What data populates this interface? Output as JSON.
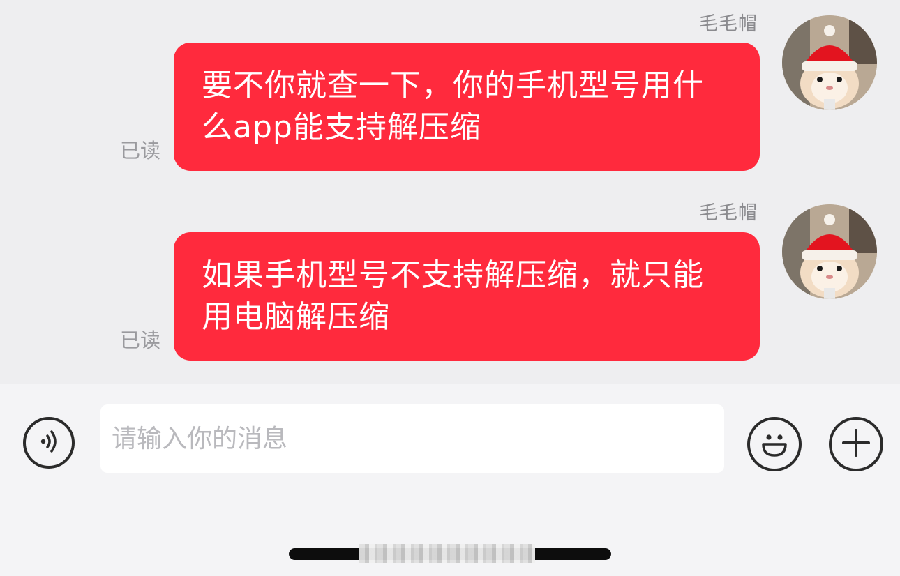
{
  "messages": [
    {
      "sender": "毛毛帽",
      "text": "要不你就查一下，你的手机型号用什么app能支持解压缩",
      "status": "已读"
    },
    {
      "sender": "毛毛帽",
      "text": "如果手机型号不支持解压缩，就只能用电脑解压缩",
      "status": "已读"
    }
  ],
  "input_bar": {
    "placeholder": "请输入你的消息",
    "voice_icon": "voice-icon",
    "emoji_icon": "emoji-icon",
    "plus_icon": "plus-icon"
  },
  "colors": {
    "bubble": "#ff2a3d",
    "chat_background": "#eeeef0",
    "input_bar_background": "#f4f4f6"
  }
}
